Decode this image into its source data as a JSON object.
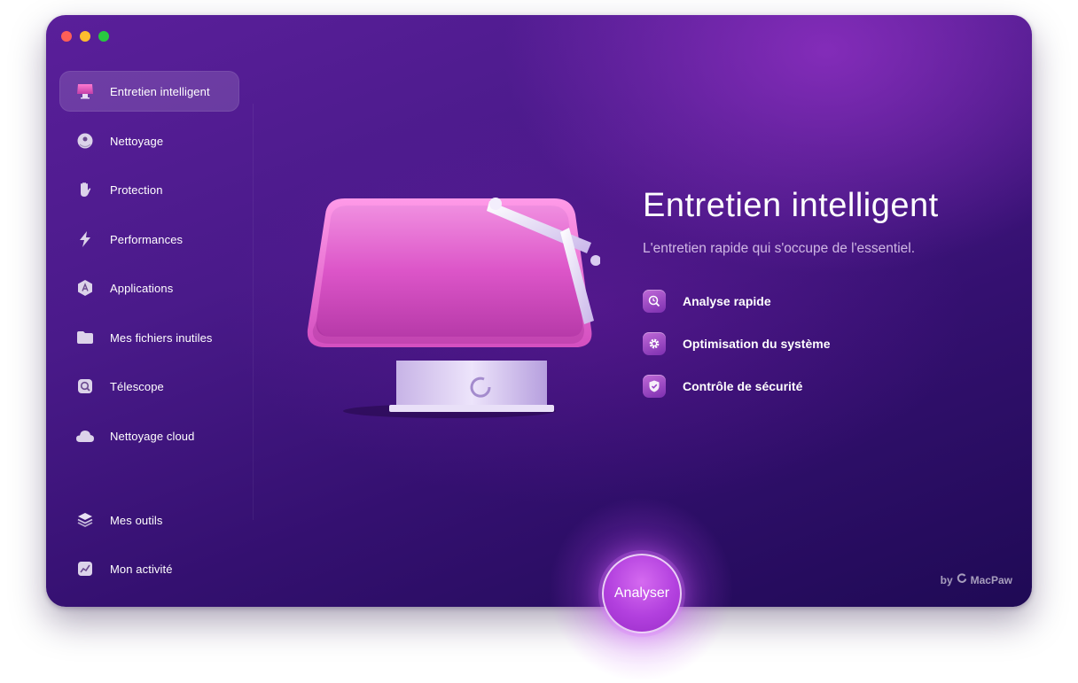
{
  "window": {
    "controls": [
      "close",
      "minimize",
      "maximize"
    ]
  },
  "sidebar": {
    "items": [
      {
        "label": "Entretien intelligent",
        "icon": "monitor-icon",
        "active": true
      },
      {
        "label": "Nettoyage",
        "icon": "disk-icon"
      },
      {
        "label": "Protection",
        "icon": "hand-icon"
      },
      {
        "label": "Performances",
        "icon": "lightning-icon"
      },
      {
        "label": "Applications",
        "icon": "applications-icon"
      },
      {
        "label": "Mes fichiers inutiles",
        "icon": "folder-icon"
      },
      {
        "label": "Télescope",
        "icon": "telescope-icon"
      },
      {
        "label": "Nettoyage cloud",
        "icon": "cloud-icon"
      }
    ],
    "bottom_items": [
      {
        "label": "Mes outils",
        "icon": "layers-icon"
      },
      {
        "label": "Mon activité",
        "icon": "activity-chart-icon"
      }
    ]
  },
  "main": {
    "title": "Entretien intelligent",
    "subtitle": "L'entretien rapide qui s'occupe de l'essentiel.",
    "features": [
      {
        "label": "Analyse rapide",
        "icon": "magnifier-clock-icon"
      },
      {
        "label": "Optimisation du système",
        "icon": "gear-icon"
      },
      {
        "label": "Contrôle de sécurité",
        "icon": "shield-check-icon"
      }
    ],
    "scan_button": "Analyser"
  },
  "branding": {
    "prefix": "by",
    "name": "MacPaw"
  },
  "colors": {
    "accent": "#b240de",
    "background_top": "#5a1f9a",
    "background_bottom": "#1f0a55"
  }
}
